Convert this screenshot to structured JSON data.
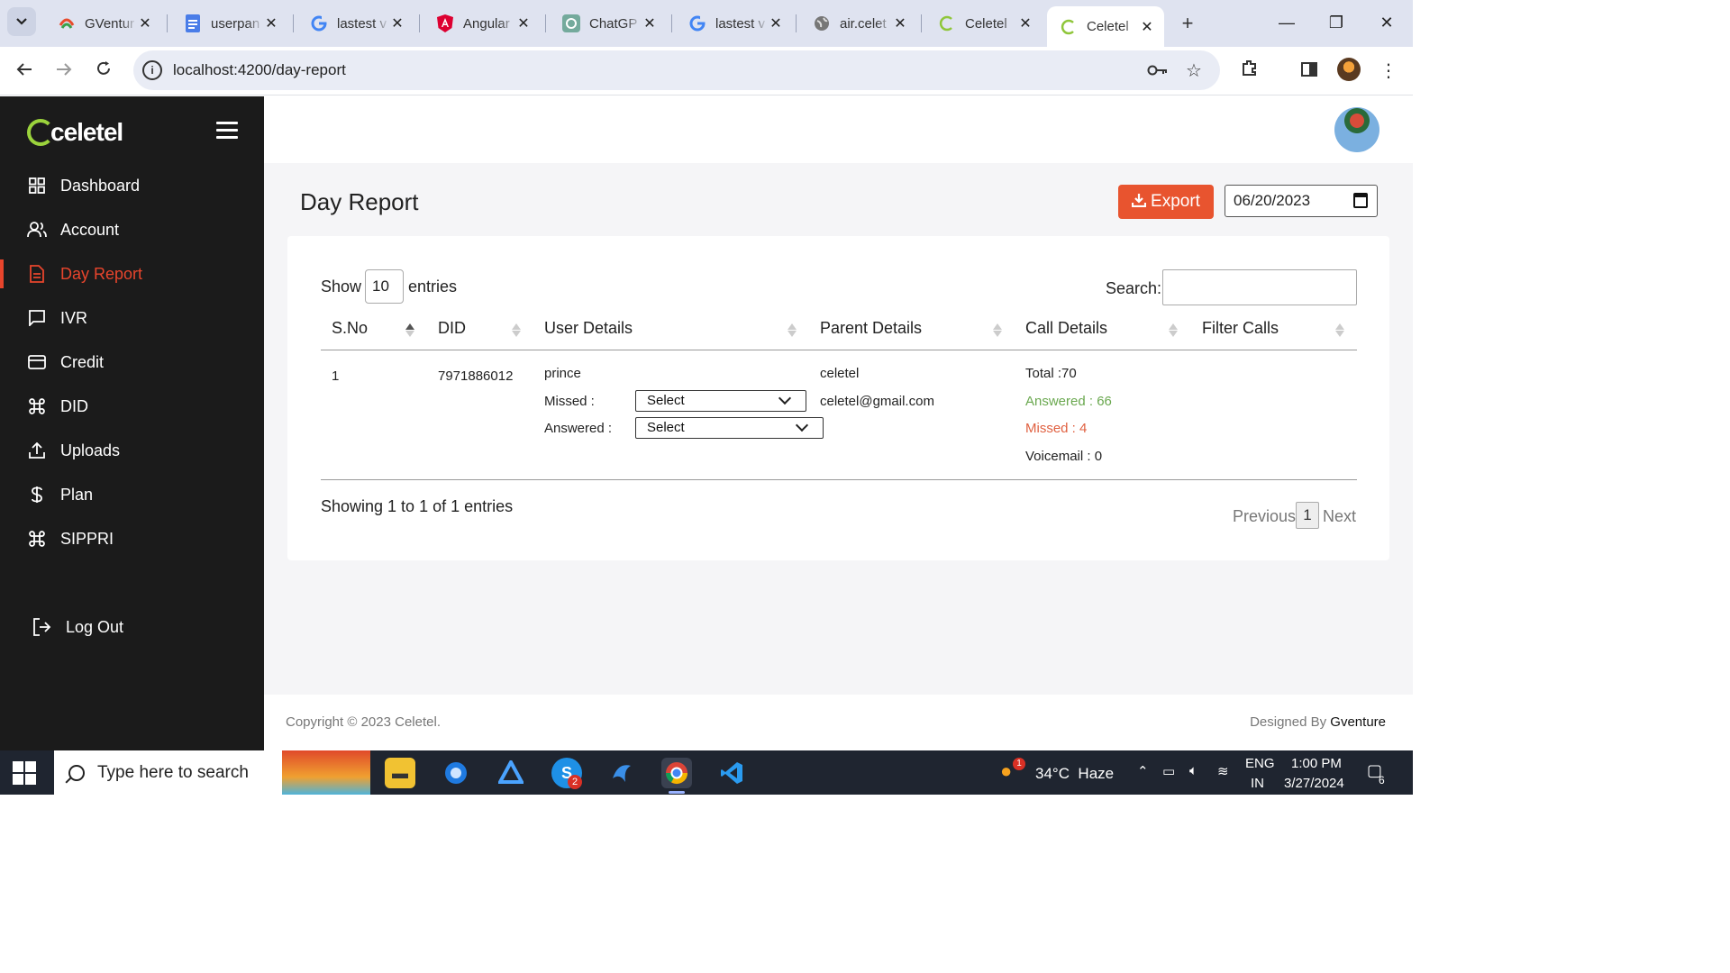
{
  "browser": {
    "tabs": [
      {
        "title": "GVentur",
        "favicon": "gventure-favicon"
      },
      {
        "title": "userpan",
        "favicon": "docs-favicon"
      },
      {
        "title": "lastest v",
        "favicon": "google-favicon"
      },
      {
        "title": "Angular",
        "favicon": "angular-favicon"
      },
      {
        "title": "ChatGP",
        "favicon": "chatgpt-favicon"
      },
      {
        "title": "lastest v",
        "favicon": "google-favicon"
      },
      {
        "title": "air.celet",
        "favicon": "globe-favicon"
      },
      {
        "title": "Celetel",
        "favicon": "celetel-favicon"
      },
      {
        "title": "Celetel",
        "favicon": "celetel-favicon",
        "active": true
      }
    ],
    "url": "localhost:4200/day-report",
    "tab_close_glyph": "✕"
  },
  "sidebar": {
    "brand": "celetel",
    "items": [
      {
        "label": "Dashboard",
        "icon": "grid-icon"
      },
      {
        "label": "Account",
        "icon": "users-icon"
      },
      {
        "label": "Day Report",
        "icon": "document-icon",
        "active": true
      },
      {
        "label": "IVR",
        "icon": "message-icon"
      },
      {
        "label": "Credit",
        "icon": "credit-card-icon"
      },
      {
        "label": "DID",
        "icon": "command-icon"
      },
      {
        "label": "Uploads",
        "icon": "upload-icon"
      },
      {
        "label": "Plan",
        "icon": "dollar-icon"
      },
      {
        "label": "SIPPRI",
        "icon": "command-icon"
      }
    ],
    "logout": "Log Out"
  },
  "page": {
    "title": "Day Report",
    "export_label": "Export",
    "date_value": "06/20/2023"
  },
  "table": {
    "show_label": "Show",
    "page_size": "10",
    "entries_label": "entries",
    "search_label": "Search:",
    "columns": [
      "S.No",
      "DID",
      "User Details",
      "Parent Details",
      "Call Details",
      "Filter Calls"
    ],
    "row": {
      "sno": "1",
      "did": "7971886012",
      "user_name": "prince",
      "missed_label": "Missed :",
      "missed_select": "Select",
      "answered_label": "Answered :",
      "answered_select": "Select",
      "parent_name": "celetel",
      "parent_email": "celetel@gmail.com",
      "total": "Total :70",
      "answered": "Answered : 66",
      "missed": "Missed : 4",
      "voicemail": "Voicemail : 0"
    },
    "info": "Showing 1 to 1 of 1 entries",
    "prev": "Previous",
    "current_page": "1",
    "next": "Next"
  },
  "footer": {
    "copyright": "Copyright © 2023 Celetel.",
    "designed_prefix": "Designed By",
    "designed_by": "Gventure"
  },
  "taskbar": {
    "search_placeholder": "Type here to search",
    "weather": "34°C  Haze",
    "weather_badge": "1",
    "lang": "ENG",
    "region": "IN",
    "time": "1:00 PM",
    "date": "3/27/2024",
    "notifications": "6",
    "skype_badge": "2"
  },
  "colors": {
    "accent": "#e8452c",
    "export_button": "#e8542f",
    "sidebar_bg": "#1b1b1b",
    "answered": "#6aa84f",
    "missed": "#e06040"
  }
}
